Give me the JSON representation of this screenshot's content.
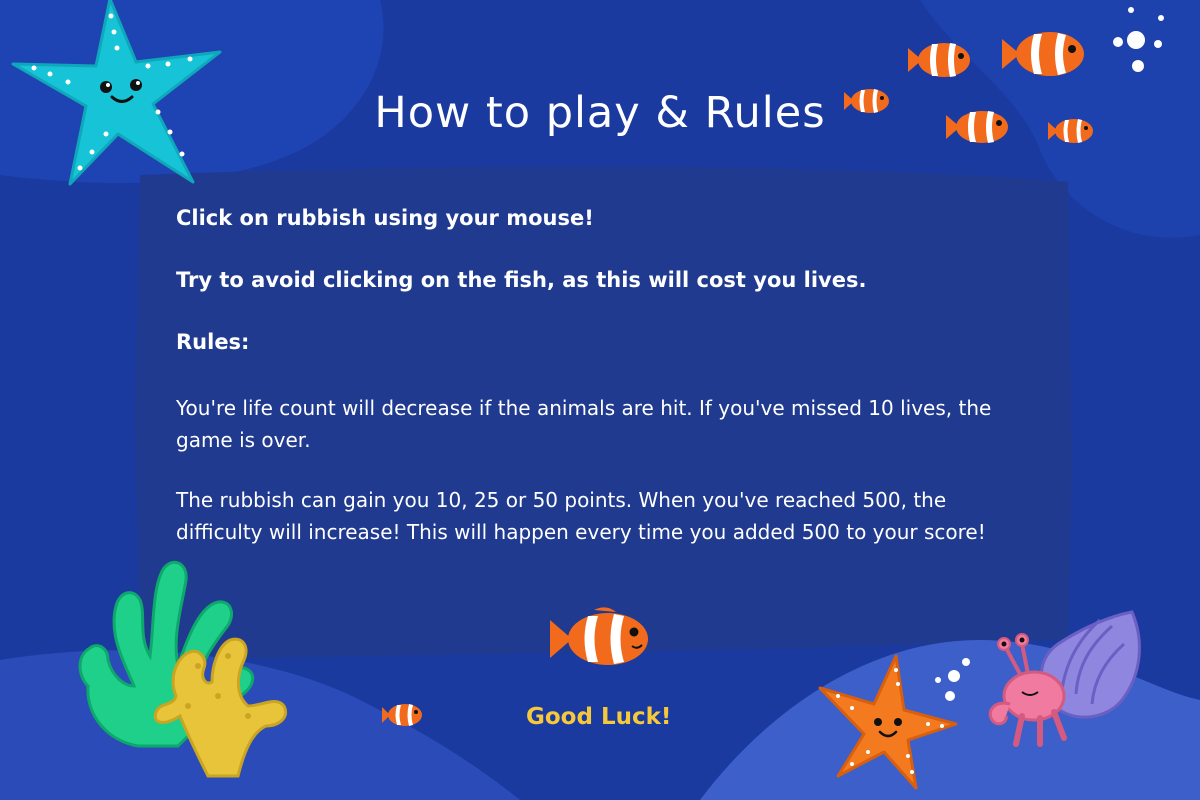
{
  "title": "How to play & Rules",
  "instructions": {
    "line1": "Click on rubbish using your mouse!",
    "line2": "Try to avoid clicking on the fish, as this will cost you lives.",
    "rules_heading": "Rules:",
    "rule1": "You're life count will decrease if the animals are hit. If you've missed 10 lives, the game is over.",
    "rule2": "The rubbish can gain you 10, 25 or 50 points. When you've reached 500, the difficulty will increase! This will happen every time you added 500 to your score!"
  },
  "footer": {
    "good_luck": "Good Luck!"
  },
  "colors": {
    "background": "#1a3a9e",
    "panel": "#1f3b90",
    "wave": "#3a5cc8",
    "title_text": "#ffffff",
    "good_luck_text": "#f5c93a"
  },
  "decorations": [
    "cyan-starfish-icon",
    "clownfish-icon",
    "bubbles-icon",
    "coral-icon",
    "orange-starfish-icon",
    "hermit-crab-icon"
  ]
}
